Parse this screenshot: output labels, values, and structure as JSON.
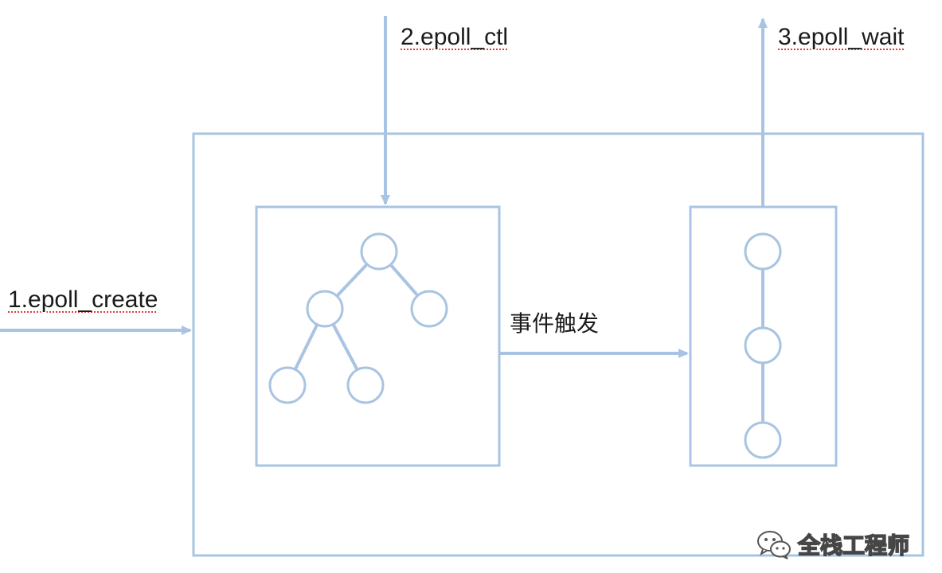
{
  "labels": {
    "epoll_create": "1.epoll_create",
    "epoll_ctl": "2.epoll_ctl",
    "epoll_wait": "3.epoll_wait",
    "event_trigger": "事件触发"
  },
  "watermark": {
    "icon": "wechat-icon",
    "text": "全栈工程师"
  },
  "colors": {
    "line": "#a9c4e2",
    "node_fill": "#ffffff",
    "text": "#1a1a1a"
  }
}
